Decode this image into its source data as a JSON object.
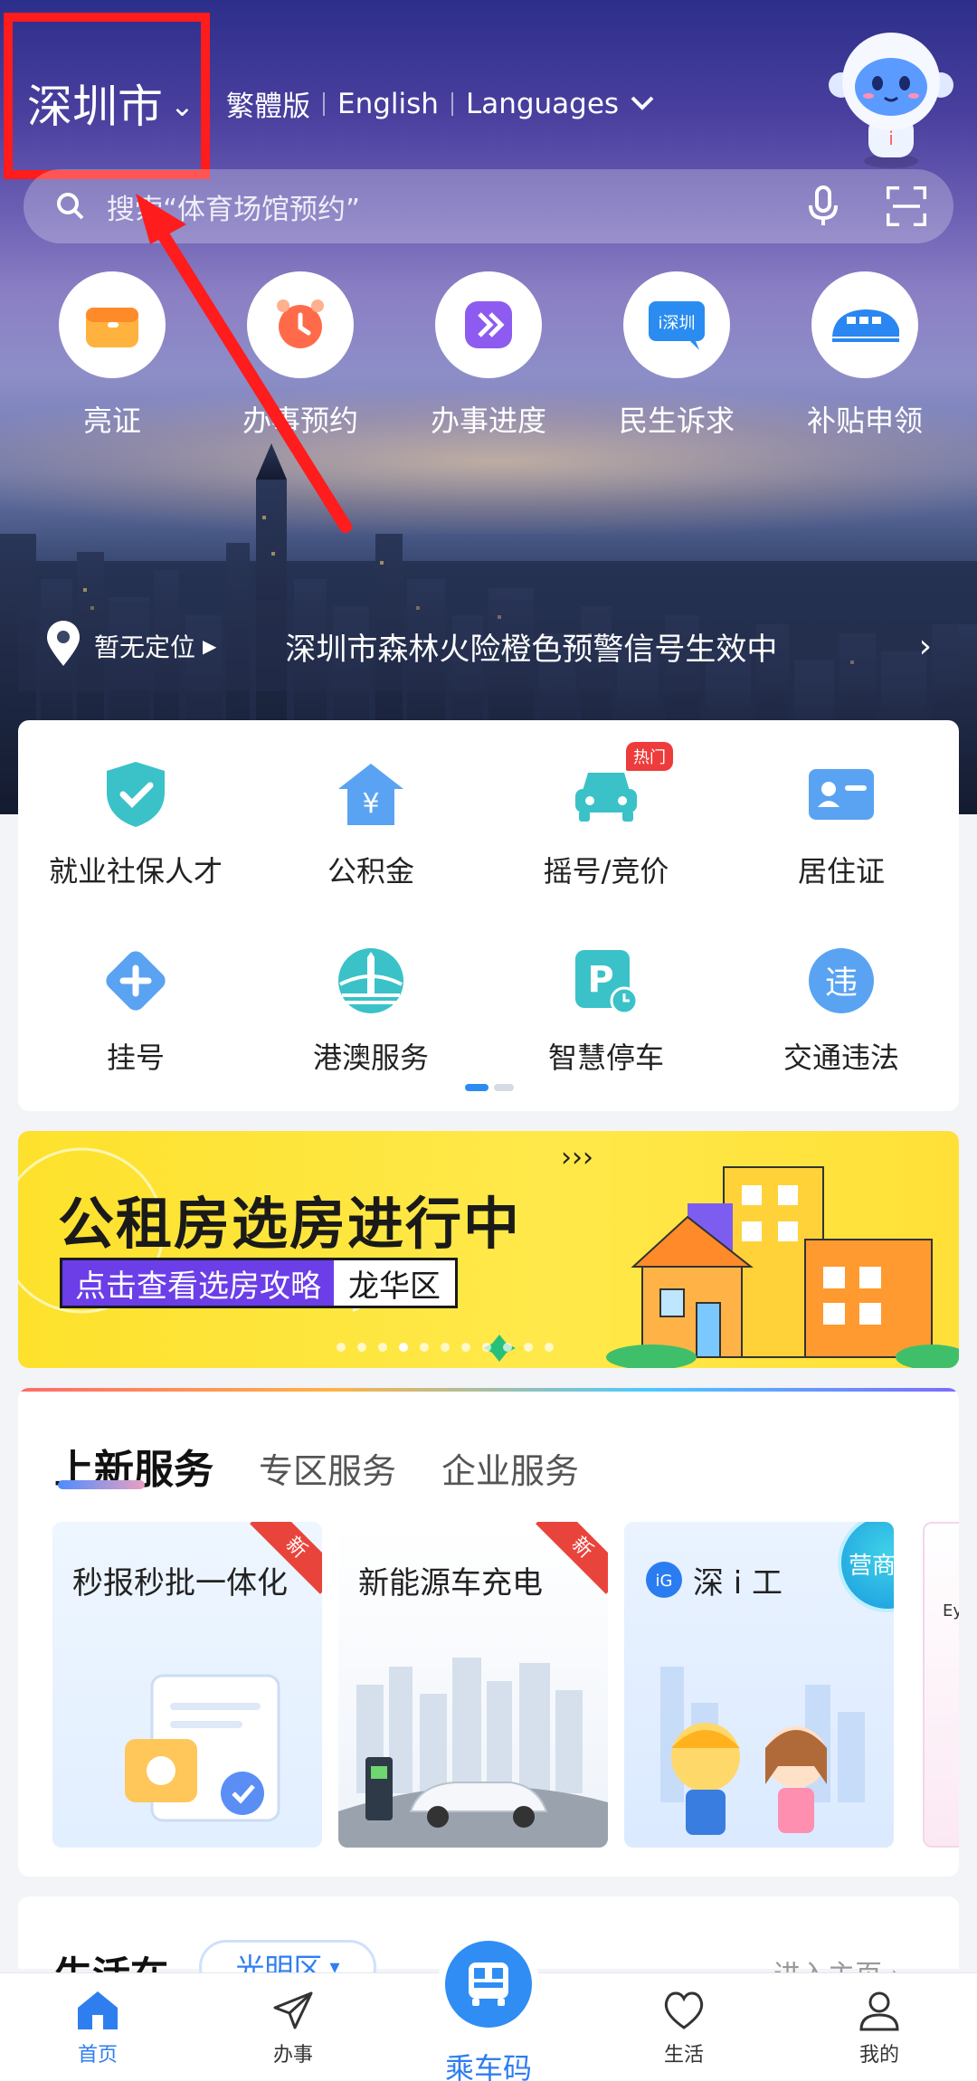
{
  "header": {
    "city": "深圳市",
    "languages": [
      "繁體版",
      "English",
      "Languages"
    ]
  },
  "search": {
    "placeholder": "搜索“体育场馆预约”"
  },
  "quick_services": [
    {
      "label": "亮证",
      "icon": "id-card-wallet-icon"
    },
    {
      "label": "办事预约",
      "icon": "alarm-clock-icon"
    },
    {
      "label": "办事进度",
      "icon": "progress-forward-icon"
    },
    {
      "label": "民生诉求",
      "icon": "shenzhen-chat-icon"
    },
    {
      "label": "补贴申领",
      "icon": "train-icon"
    }
  ],
  "location_bar": {
    "location": "暂无定位",
    "notice": "深圳市森林火险橙色预警信号生效中"
  },
  "service_grid": [
    {
      "label": "就业社保人才",
      "icon": "shield-check-icon"
    },
    {
      "label": "公积金",
      "icon": "housing-fund-icon"
    },
    {
      "label": "摇号/竞价",
      "icon": "car-icon",
      "badge": "热门"
    },
    {
      "label": "居住证",
      "icon": "residence-card-icon"
    },
    {
      "label": "挂号",
      "icon": "medical-cross-icon"
    },
    {
      "label": "港澳服务",
      "icon": "bridge-icon"
    },
    {
      "label": "智慧停车",
      "icon": "parking-icon"
    },
    {
      "label": "交通违法",
      "icon": "traffic-violation-icon"
    }
  ],
  "banner": {
    "title": "公租房选房进行中",
    "link": "点击查看选房攻略",
    "district": "龙华区",
    "arrows": "›››"
  },
  "new_services": {
    "tabs": [
      "上新服务",
      "专区服务",
      "企业服务"
    ],
    "tiles": [
      {
        "title": "秒报秒批一体化",
        "badge": "新"
      },
      {
        "title": "新能源车充电",
        "badge": "新"
      },
      {
        "title": "深 i 工",
        "badge": "营商通"
      }
    ],
    "peek_text": "Ey"
  },
  "living": {
    "title": "生活在",
    "district": "光明区",
    "enter": "进入主页"
  },
  "bottom_nav": {
    "items": [
      "首页",
      "办事",
      "乘车码",
      "生活",
      "我的"
    ],
    "active": "首页"
  },
  "colors": {
    "accent": "#2f7ef0",
    "highlight": "#ff1c1c",
    "banner_yellow": "#fde12c",
    "banner_purple": "#6b3ee8"
  }
}
